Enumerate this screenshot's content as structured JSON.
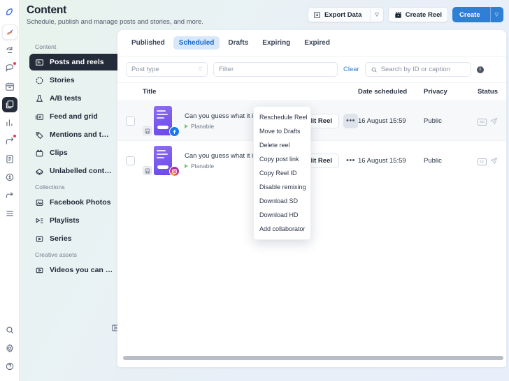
{
  "rail": {
    "top_icons": [
      {
        "name": "planable-logo-icon",
        "dot": false
      },
      {
        "name": "ai-assistant-icon",
        "dot": false
      },
      {
        "name": "approvals-icon",
        "dot": false
      },
      {
        "name": "notifications-icon",
        "dot": true
      },
      {
        "name": "calendar-icon",
        "dot": false
      },
      {
        "name": "content-icon",
        "dot": false
      },
      {
        "name": "analytics-icon",
        "dot": false
      },
      {
        "name": "engagement-icon",
        "dot": true
      },
      {
        "name": "reports-icon",
        "dot": false
      },
      {
        "name": "billing-icon",
        "dot": false
      },
      {
        "name": "share-icon",
        "dot": false
      },
      {
        "name": "list-icon",
        "dot": false
      }
    ],
    "bottom_icons": [
      {
        "name": "search-icon"
      },
      {
        "name": "settings-gear-icon"
      },
      {
        "name": "help-icon"
      }
    ]
  },
  "header": {
    "title": "Content",
    "subtitle": "Schedule, publish and manage posts and stories, and more.",
    "export_label": "Export Data",
    "create_reel_label": "Create Reel",
    "create_label": "Create",
    "accent_blue": "#2f7fd4"
  },
  "sidebar": {
    "groups": [
      {
        "caption": "Content",
        "items": [
          {
            "label": "Posts and reels",
            "icon": "posts-and-reels-icon",
            "selected": true
          },
          {
            "label": "Stories",
            "icon": "stories-icon",
            "selected": false
          },
          {
            "label": "A/B tests",
            "icon": "ab-tests-icon",
            "selected": false
          },
          {
            "label": "Feed and grid",
            "icon": "feed-and-grid-icon",
            "selected": false
          },
          {
            "label": "Mentions and t…",
            "icon": "mentions-and-tags-icon",
            "selected": false
          },
          {
            "label": "Clips",
            "icon": "clips-icon",
            "selected": false
          },
          {
            "label": "Unlabelled cont…",
            "icon": "unlabelled-content-icon",
            "selected": false
          }
        ]
      },
      {
        "caption": "Collections",
        "items": [
          {
            "label": "Facebook Photos",
            "icon": "facebook-photos-icon",
            "selected": false
          },
          {
            "label": "Playlists",
            "icon": "playlists-icon",
            "selected": false
          },
          {
            "label": "Series",
            "icon": "series-icon",
            "selected": false
          }
        ]
      },
      {
        "caption": "Creative assets",
        "items": [
          {
            "label": "Videos you can …",
            "icon": "videos-icon",
            "selected": false
          }
        ]
      }
    ],
    "collapse_icon": "collapse-sidebar-icon"
  },
  "tabs": [
    {
      "label": "Published",
      "active": false
    },
    {
      "label": "Scheduled",
      "active": true
    },
    {
      "label": "Drafts",
      "active": false
    },
    {
      "label": "Expiring",
      "active": false
    },
    {
      "label": "Expired",
      "active": false
    }
  ],
  "filters": {
    "post_type_value": "Post type",
    "filter_placeholder": "Filter",
    "clear_label": "Clear",
    "search_placeholder": "Search by ID or caption",
    "info_glyph": "i"
  },
  "table": {
    "columns": {
      "title": "Title",
      "date_scheduled": "Date scheduled",
      "privacy": "Privacy",
      "status": "Status"
    },
    "rows": [
      {
        "caption": "Can you guess what it is? We're …",
        "workspace": "Planable",
        "network": "facebook",
        "edit_label": "Edit Reel",
        "menu_open": true,
        "date": "16 August 15:59",
        "privacy": "Public",
        "status_icons": [
          "cc-badge",
          "send-icon"
        ],
        "cc_label": "cc"
      },
      {
        "caption": "Can you guess what it is? We're …",
        "workspace": "Planable",
        "network": "instagram",
        "edit_label": "Edit Reel",
        "menu_open": false,
        "date": "16 August 15:59",
        "privacy": "Public",
        "status_icons": [
          "cc-badge",
          "send-icon"
        ],
        "cc_label": "cc"
      }
    ]
  },
  "context_menu": {
    "items": [
      "Reschedule Reel",
      "Move to Drafts",
      "Delete reel",
      "Copy post link",
      "Copy Reel ID",
      "Disable remixing",
      "Download SD",
      "Download HD",
      "Add collaborator"
    ]
  }
}
